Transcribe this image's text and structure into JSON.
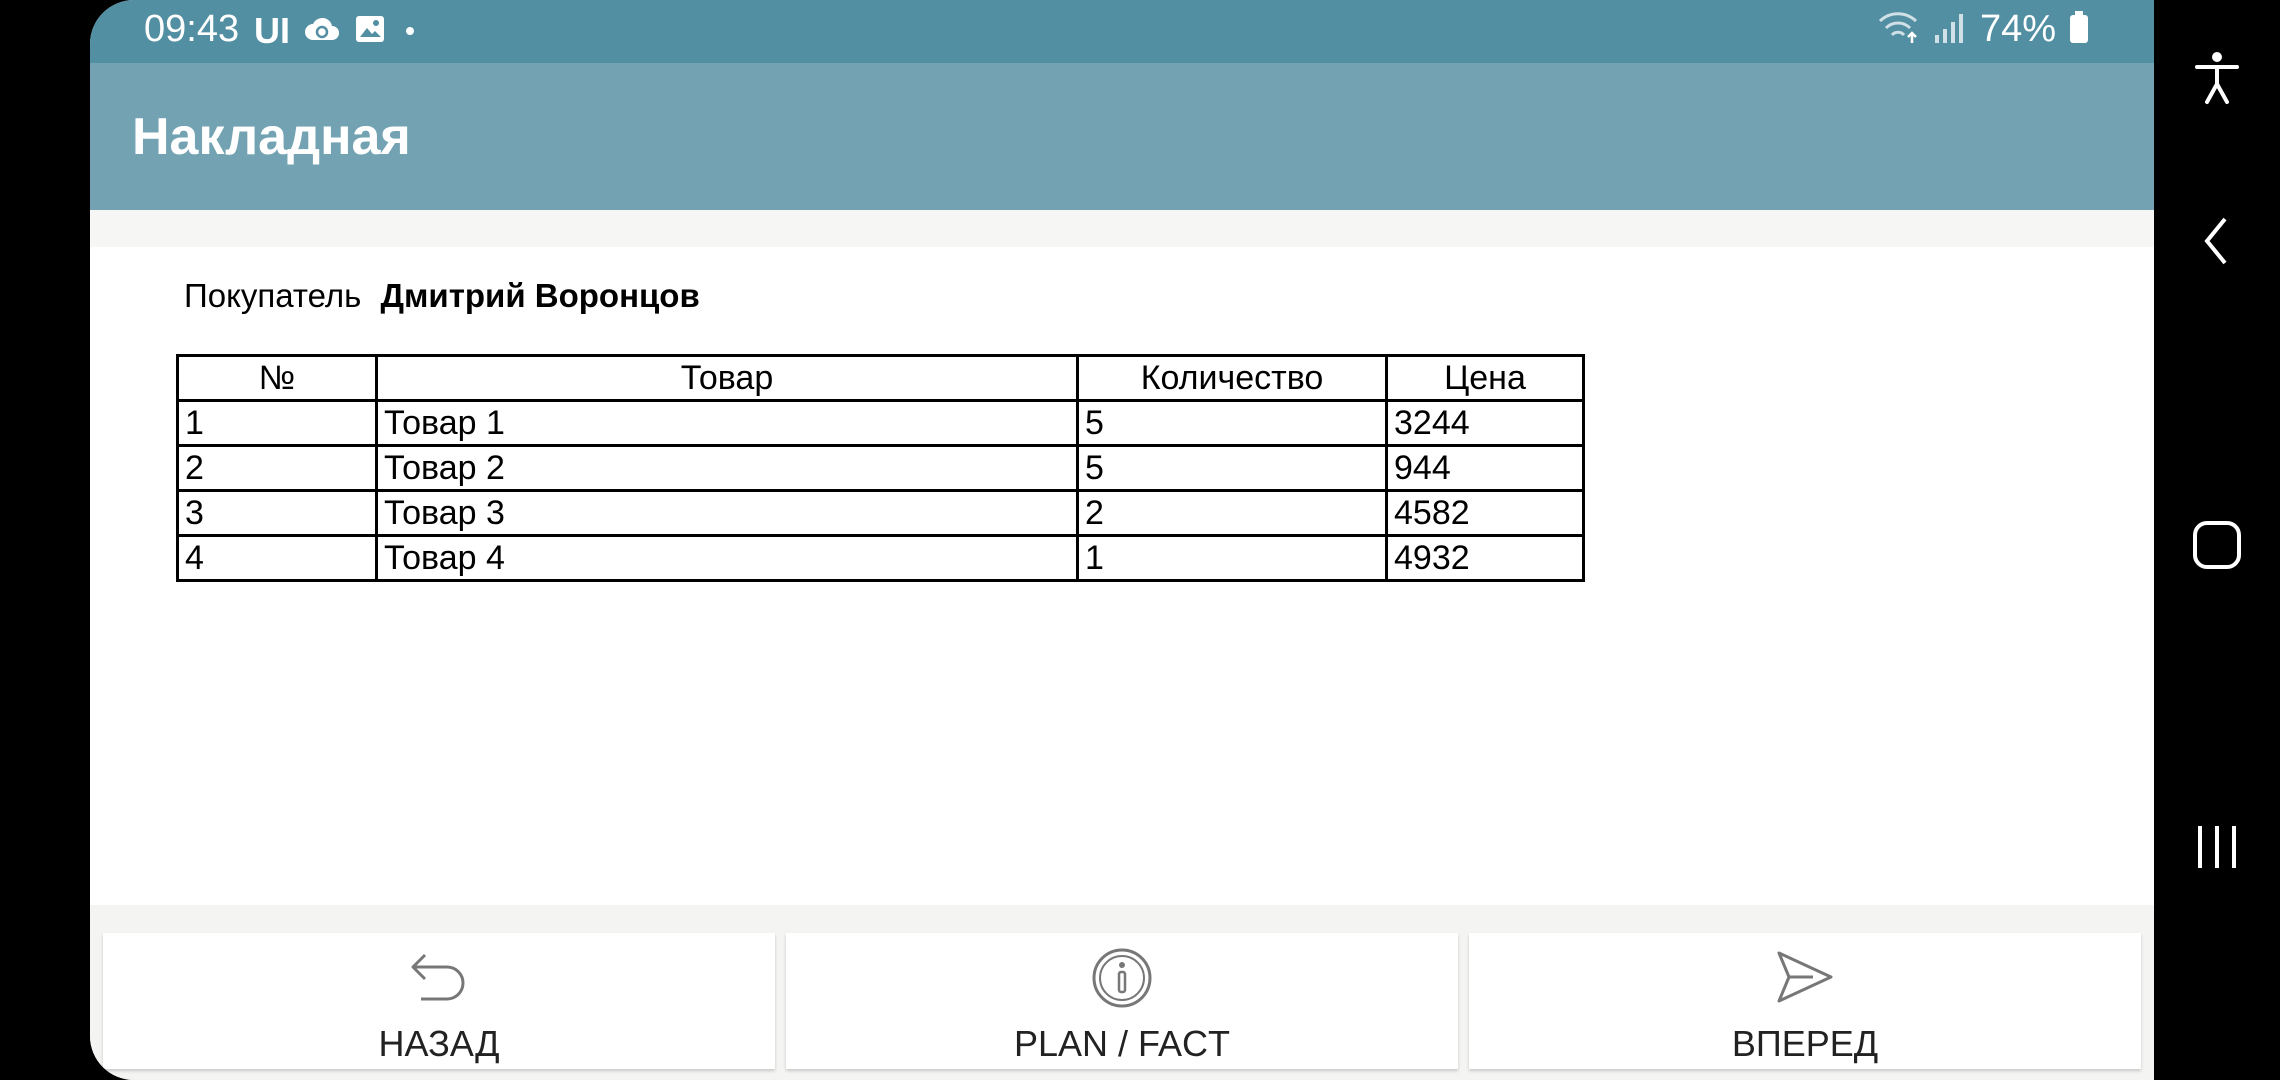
{
  "status_bar": {
    "time": "09:43",
    "ui_label": "UI",
    "battery": "74%",
    "icons": [
      "cloud-sync-icon",
      "image-icon",
      "dot-icon",
      "wifi-icon",
      "signal-icon",
      "battery-icon"
    ]
  },
  "app_bar": {
    "title": "Накладная"
  },
  "customer": {
    "label": "Покупатель",
    "name": "Дмитрий Воронцов"
  },
  "table": {
    "headers": [
      "№",
      "Товар",
      "Количество",
      "Цена"
    ],
    "rows": [
      [
        "1",
        "Товар 1",
        "5",
        "3244"
      ],
      [
        "2",
        "Товар 2",
        "5",
        "944"
      ],
      [
        "3",
        "Товар 3",
        "2",
        "4582"
      ],
      [
        "4",
        "Товар 4",
        "1",
        "4932"
      ]
    ]
  },
  "buttons": {
    "back": {
      "label": "НАЗАД",
      "icon": "undo-arrow-icon"
    },
    "plan_fact": {
      "label": "PLAN / FACT",
      "icon": "info-icon"
    },
    "forward": {
      "label": "ВПЕРЕД",
      "icon": "send-icon"
    }
  },
  "system_nav": [
    "accessibility-icon",
    "back-icon",
    "home-icon",
    "recents-icon"
  ],
  "colors": {
    "status_bar": "#528fa2",
    "app_bar": "#73a3b3"
  }
}
